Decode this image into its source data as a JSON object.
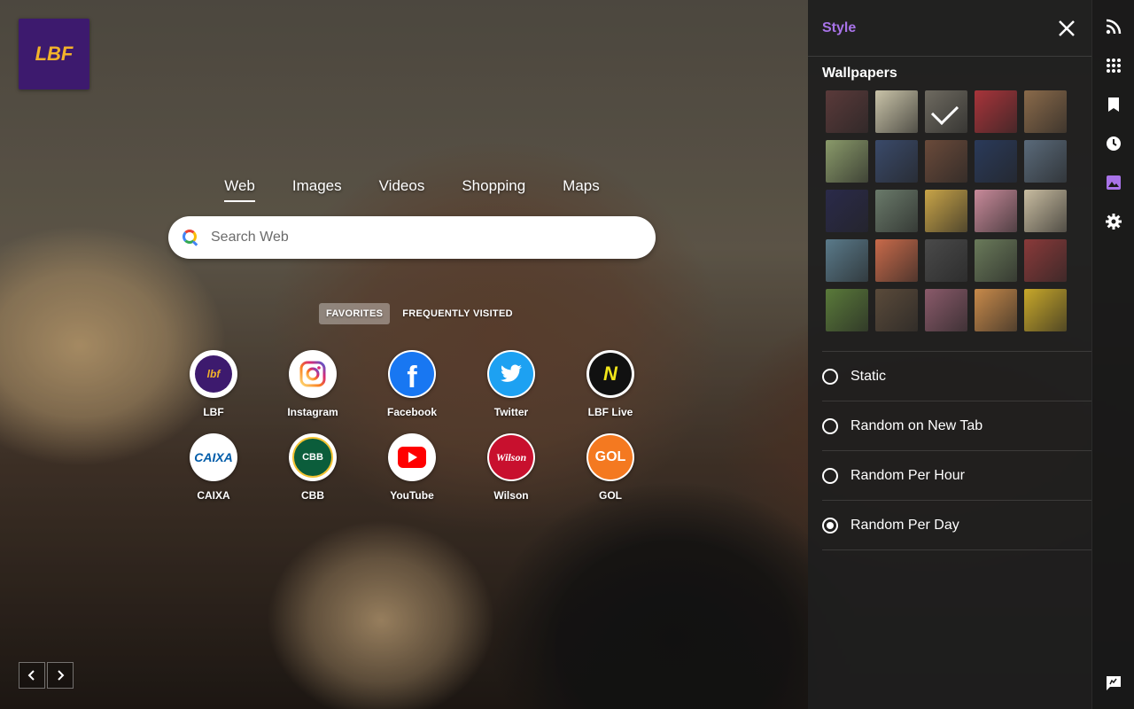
{
  "logo": {
    "text": "LBF",
    "icon": "lbf-logo"
  },
  "search": {
    "tabs": [
      {
        "label": "Web",
        "active": true
      },
      {
        "label": "Images",
        "active": false
      },
      {
        "label": "Videos",
        "active": false
      },
      {
        "label": "Shopping",
        "active": false
      },
      {
        "label": "Maps",
        "active": false
      }
    ],
    "placeholder": "Search Web"
  },
  "favorites_tabs": [
    {
      "label": "FAVORITES",
      "active": true
    },
    {
      "label": "FREQUENTLY VISITED",
      "active": false
    }
  ],
  "tiles": [
    {
      "label": "LBF",
      "icon": "lbf-icon",
      "color": "#3d1a6e"
    },
    {
      "label": "Instagram",
      "icon": "instagram-icon",
      "color": "#d6249f"
    },
    {
      "label": "Facebook",
      "icon": "facebook-icon",
      "color": "#1877f2"
    },
    {
      "label": "Twitter",
      "icon": "twitter-icon",
      "color": "#1da1f2"
    },
    {
      "label": "LBF Live",
      "icon": "lbf-live-icon",
      "color": "#111111"
    },
    {
      "label": "CAIXA",
      "icon": "caixa-icon",
      "color": "#005ca9"
    },
    {
      "label": "CBB",
      "icon": "cbb-icon",
      "color": "#0b5d3b"
    },
    {
      "label": "YouTube",
      "icon": "youtube-icon",
      "color": "#ff0000"
    },
    {
      "label": "Wilson",
      "icon": "wilson-icon",
      "color": "#c8102e"
    },
    {
      "label": "GOL",
      "icon": "gol-icon",
      "color": "#f47920"
    }
  ],
  "panel": {
    "title": "Style",
    "wallpapers_title": "Wallpapers",
    "wallpapers": [
      {
        "color": "#5a3a3a"
      },
      {
        "color": "#c9c3a8"
      },
      {
        "color": "#6e6a60",
        "selected": true
      },
      {
        "color": "#a8343a"
      },
      {
        "color": "#8a6a4a"
      },
      {
        "color": "#8a9a6a"
      },
      {
        "color": "#3a4a6a"
      },
      {
        "color": "#6a4a3a"
      },
      {
        "color": "#2a3a5a"
      },
      {
        "color": "#5a6a7a"
      },
      {
        "color": "#2a2a4a"
      },
      {
        "color": "#6a7a6a"
      },
      {
        "color": "#c8a448"
      },
      {
        "color": "#c88a9a"
      },
      {
        "color": "#c8bca0"
      },
      {
        "color": "#5a7a8a"
      },
      {
        "color": "#c86a4a"
      },
      {
        "color": "#4a4a4a"
      },
      {
        "color": "#6a7a5a"
      },
      {
        "color": "#8a3a3a"
      },
      {
        "color": "#5a7a3a"
      },
      {
        "color": "#5a4a3a"
      },
      {
        "color": "#8a5a6a"
      },
      {
        "color": "#c88a4a"
      },
      {
        "color": "#c8a82a"
      }
    ],
    "options": [
      {
        "label": "Static",
        "checked": false
      },
      {
        "label": "Random on New Tab",
        "checked": false
      },
      {
        "label": "Random Per Hour",
        "checked": false
      },
      {
        "label": "Random Per Day",
        "checked": true
      }
    ]
  },
  "rail": [
    {
      "icon": "rss-icon"
    },
    {
      "icon": "apps-grid-icon"
    },
    {
      "icon": "bookmark-icon"
    },
    {
      "icon": "history-icon"
    },
    {
      "icon": "wallpaper-icon",
      "active": true
    },
    {
      "icon": "settings-icon"
    },
    {
      "icon": "feedback-icon"
    }
  ],
  "colors": {
    "accent": "#a873e8"
  }
}
